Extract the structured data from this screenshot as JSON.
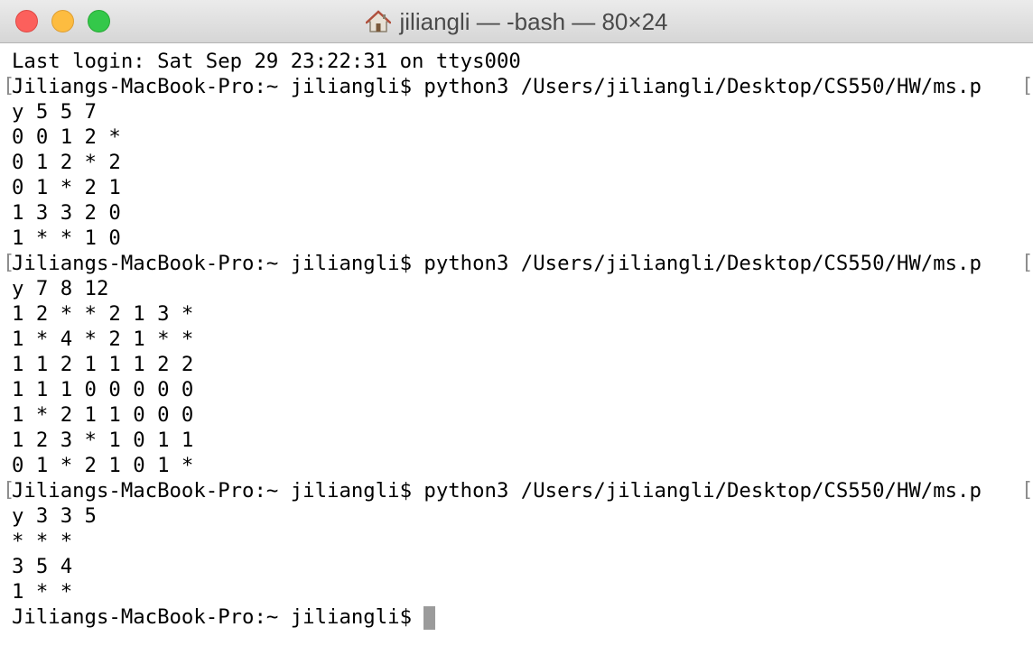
{
  "window": {
    "title": "jiliangli — -bash — 80×24",
    "home_icon": "house-icon",
    "colors": {
      "close": "#fc605c",
      "minimize": "#fdbc40",
      "zoom": "#34c84a",
      "cursor": "#9b9b9b",
      "bracket": "#8c8c8c"
    }
  },
  "terminal": {
    "lines": [
      "Last login: Sat Sep 29 23:22:31 on ttys000",
      "Jiliangs-MacBook-Pro:~ jiliangli$ python3 /Users/jiliangli/Desktop/CS550/HW/ms.p",
      "y 5 5 7",
      "0 0 1 2 *",
      "0 1 2 * 2",
      "0 1 * 2 1",
      "1 3 3 2 0",
      "1 * * 1 0",
      "Jiliangs-MacBook-Pro:~ jiliangli$ python3 /Users/jiliangli/Desktop/CS550/HW/ms.p",
      "y 7 8 12",
      "1 2 * * 2 1 3 *",
      "1 * 4 * 2 1 * *",
      "1 1 2 1 1 1 2 2",
      "1 1 1 0 0 0 0 0",
      "1 * 2 1 1 0 0 0",
      "1 2 3 * 1 0 1 1",
      "0 1 * 2 1 0 1 *",
      "Jiliangs-MacBook-Pro:~ jiliangli$ python3 /Users/jiliangli/Desktop/CS550/HW/ms.p",
      "y 3 3 5",
      "* * *",
      "3 5 4",
      "1 * *",
      "Jiliangs-MacBook-Pro:~ jiliangli$"
    ],
    "bracket_left": "[",
    "bracket_right": "["
  }
}
